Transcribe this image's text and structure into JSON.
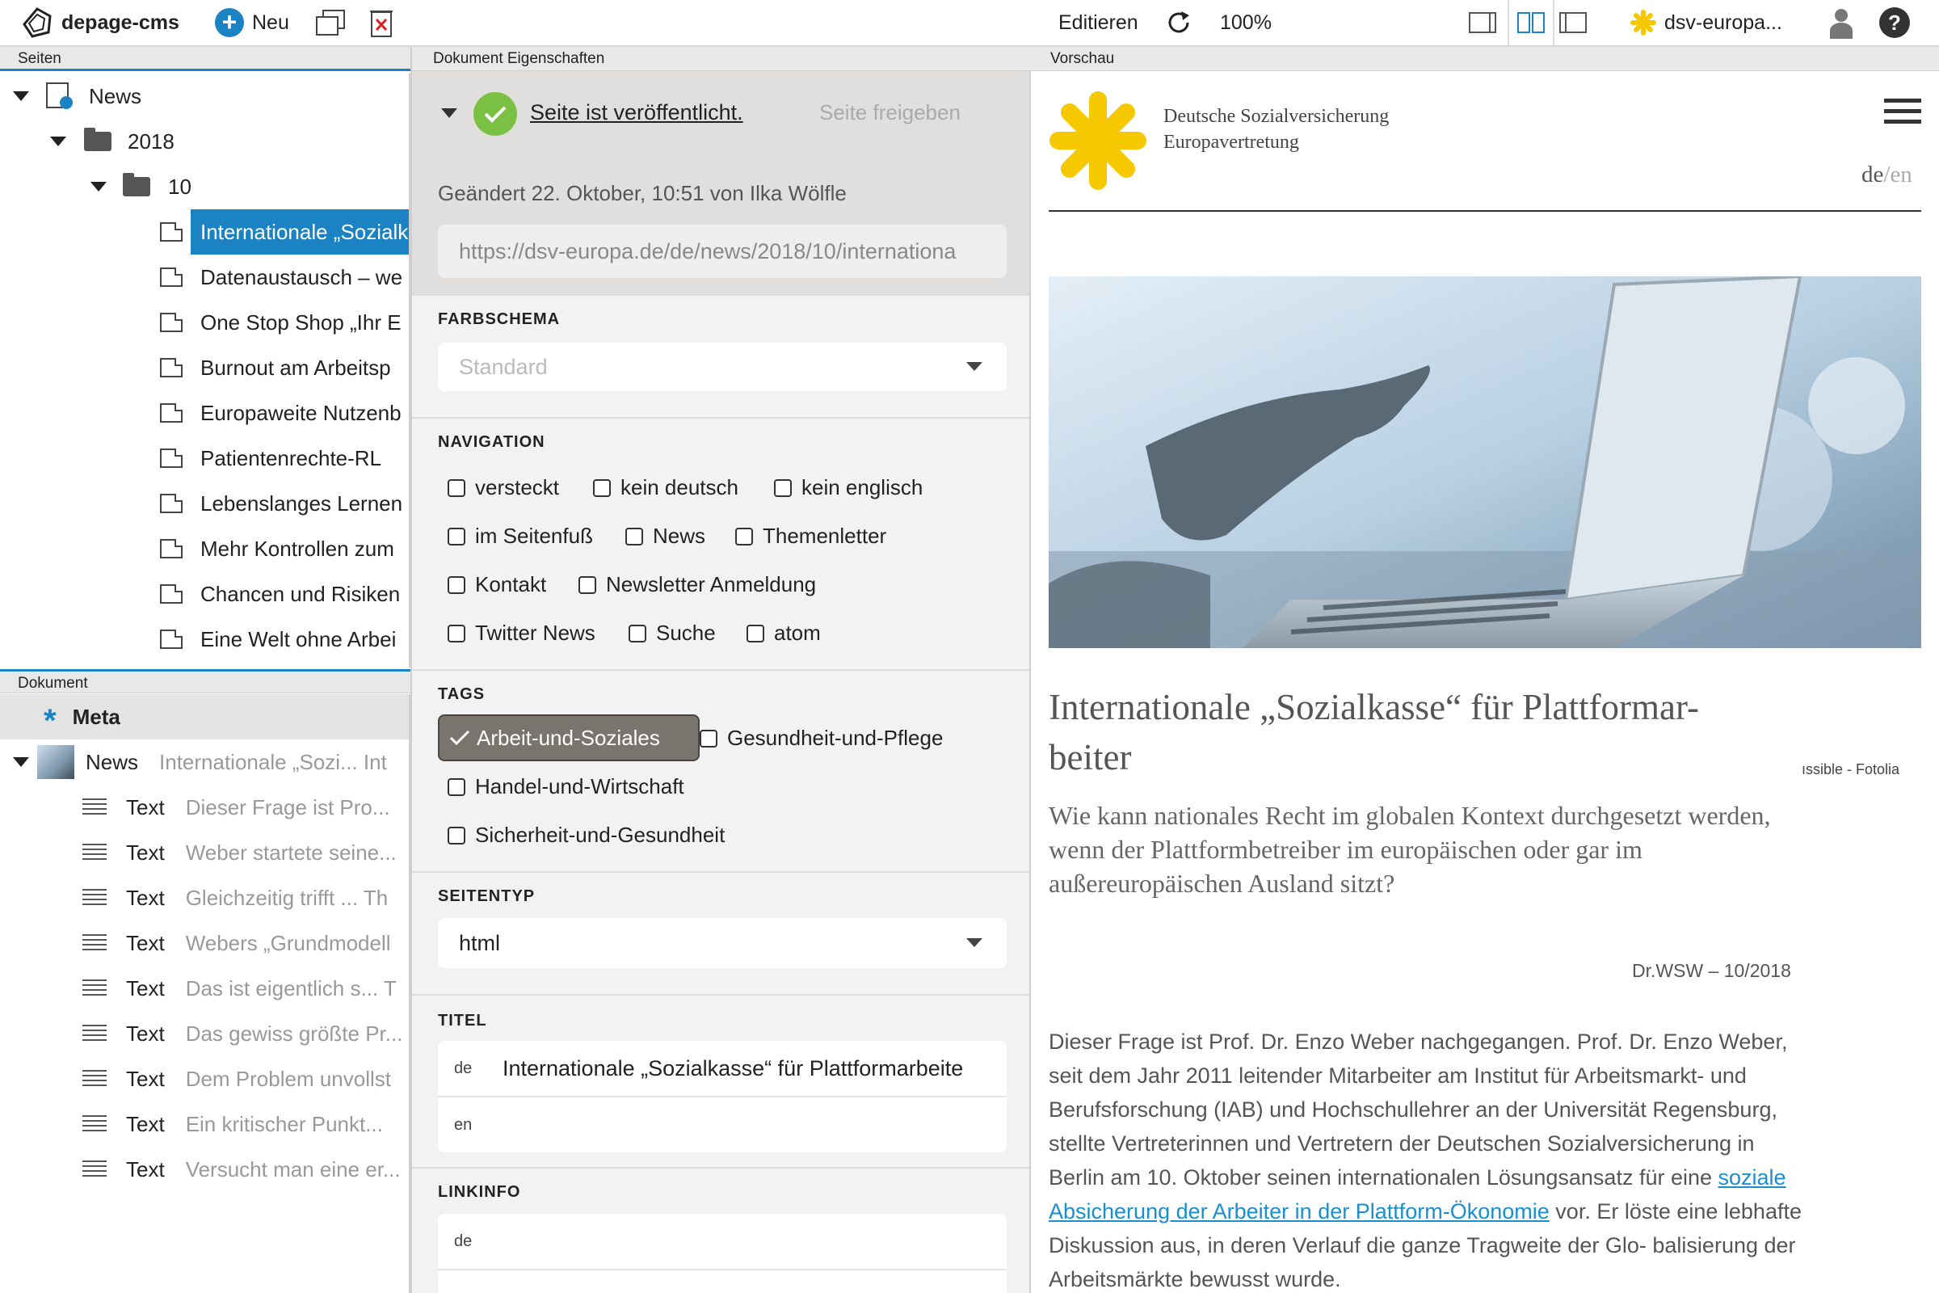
{
  "toolbar": {
    "app_name": "depage-cms",
    "new_label": "Neu",
    "edit_label": "Editieren",
    "zoom": "100%",
    "project": "dsv-europa...",
    "help": "?"
  },
  "panes": {
    "pages": "Seiten",
    "document": "Dokument",
    "properties": "Dokument Eigenschaften",
    "preview": "Vorschau"
  },
  "tree": {
    "root": "News",
    "year": "2018",
    "month": "10",
    "pages": [
      "Internationale „Sozialkasse“",
      "Datenaustausch – we",
      "One Stop Shop „Ihr E",
      "Burnout am Arbeitsp",
      "Europaweite Nutzenb",
      "Patientenrechte-RL",
      "Lebenslanges Lernen",
      "Mehr Kontrollen zum",
      "Chancen und Risiken",
      "Eine Welt ohne Arbei"
    ]
  },
  "doc": {
    "meta": "Meta",
    "news_label": "News",
    "news_preview": "Internationale „Sozi... Int",
    "items": [
      {
        "label": "Text",
        "preview": "Dieser Frage ist Pro..."
      },
      {
        "label": "Text",
        "preview": "Weber startete seine..."
      },
      {
        "label": "Text",
        "preview": "Gleichzeitig trifft ... Th"
      },
      {
        "label": "Text",
        "preview": "Webers „Grundmodell"
      },
      {
        "label": "Text",
        "preview": "Das ist eigentlich s... T"
      },
      {
        "label": "Text",
        "preview": "Das gewiss größte Pr..."
      },
      {
        "label": "Text",
        "preview": "Dem Problem unvollst"
      },
      {
        "label": "Text",
        "preview": "Ein kritischer Punkt..."
      },
      {
        "label": "Text",
        "preview": "Versucht man eine er..."
      }
    ]
  },
  "props": {
    "published": "Seite ist veröffentlicht.",
    "release": "Seite freigeben",
    "changed": "Geändert 22. Oktober, 10:51 von Ilka Wölfle",
    "url": "https://dsv-europa.de/de/news/2018/10/internationa",
    "colorscheme_title": "FARBSCHEMA",
    "colorscheme_placeholder": "Standard",
    "nav_title": "NAVIGATION",
    "nav": [
      "versteckt",
      "kein deutsch",
      "kein englisch",
      "im Seitenfuß",
      "News",
      "Themenletter",
      "Kontakt",
      "Newsletter Anmeldung",
      "Twitter News",
      "Suche",
      "atom"
    ],
    "tags_title": "TAGS",
    "tags": [
      "Arbeit-und-Soziales",
      "Gesundheit-und-Pflege",
      "Handel-und-Wirtschaft",
      "Sicherheit-und-Gesundheit"
    ],
    "pagetype_title": "SEITENTYP",
    "pagetype": "html",
    "title_title": "TITEL",
    "title_de_lang": "de",
    "title_de": "Internationale „Sozialkasse“ für Plattformarbeite",
    "title_en_lang": "en",
    "linkinfo_title": "LINKINFO",
    "linkinfo_de_lang": "de"
  },
  "preview": {
    "org_line1": "Deutsche Sozialversicherung",
    "org_line2": "Europavertretung",
    "lang_de": "de",
    "lang_sep": "/",
    "lang_en": "en",
    "credit": "ıssible - Fotolia",
    "headline_1": "Internationale „Sozialkasse“ für Plattformar-",
    "headline_2": "beiter",
    "lead": "Wie kann nationales Recht im globalen Kontext durchgesetzt werden, wenn der Plattformbetreiber im europäischen oder gar im außereuropäischen Ausland sitzt?",
    "author": "Dr.WSW – 10/2018",
    "body_before": "Dieser Frage ist Prof. Dr. Enzo Weber nachgegangen. Prof. Dr. Enzo Weber, seit dem Jahr 2011 leitender Mitarbeiter am Institut für Arbeitsmarkt- und Berufsforschung (IAB) und Hochschullehrer an der Universität Regensburg, stellte Vertreterinnen und Vertretern der Deutschen Sozialversicherung in Berlin am 10. Oktober seinen internationalen Lösungsansatz für eine ",
    "body_link": "soziale Absicherung der Arbeiter in der Plattform-Ökonomie",
    "body_after": " vor. Er löste eine lebhafte Diskussion aus, in deren Verlauf die ganze Tragweite der Glo- balisierung der Arbeitsmärkte bewusst wurde."
  },
  "colors": {
    "accent": "#1b82c4",
    "published_green": "#7ac143",
    "logo_yellow": "#f6c800",
    "link": "#1a8fd0"
  }
}
